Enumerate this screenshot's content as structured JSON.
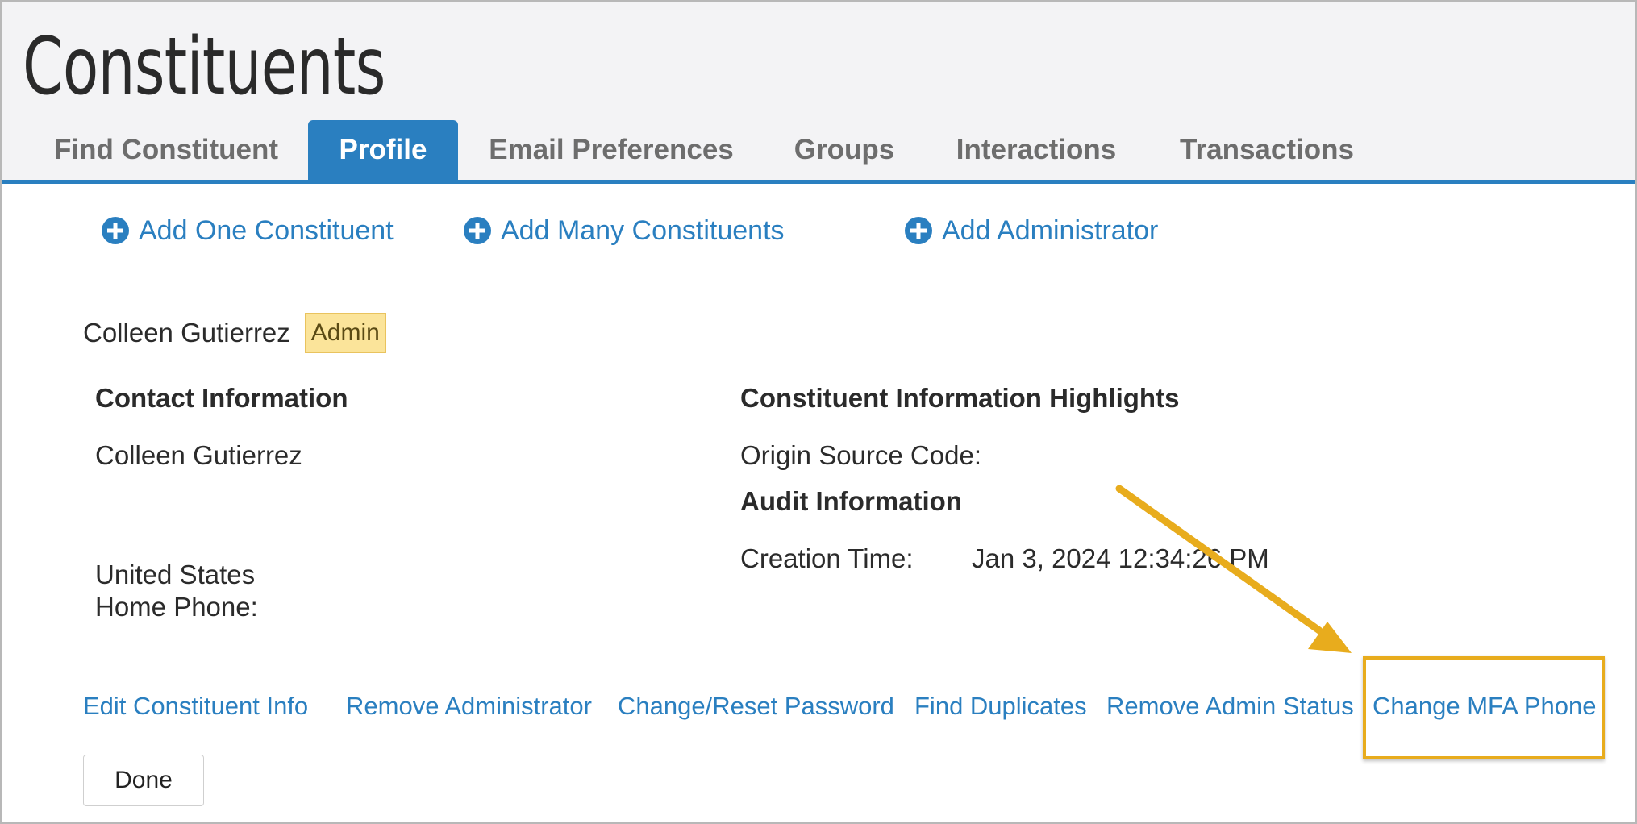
{
  "page": {
    "title": "Constituents"
  },
  "tabs": [
    {
      "label": "Find Constituent",
      "active": false
    },
    {
      "label": "Profile",
      "active": true
    },
    {
      "label": "Email Preferences",
      "active": false
    },
    {
      "label": "Groups",
      "active": false
    },
    {
      "label": "Interactions",
      "active": false
    },
    {
      "label": "Transactions",
      "active": false
    }
  ],
  "add_links": {
    "add_one": "Add One Constituent",
    "add_many": "Add Many Constituents",
    "add_admin": "Add Administrator"
  },
  "constituent": {
    "name": "Colleen Gutierrez",
    "badge": "Admin"
  },
  "contact": {
    "heading": "Contact Information",
    "name": "Colleen Gutierrez",
    "country": "United States",
    "home_phone_label": "Home Phone:"
  },
  "highlights": {
    "heading": "Constituent Information Highlights",
    "origin_label": "Origin Source Code:",
    "audit_heading": "Audit Information",
    "creation_label": "Creation Time:",
    "creation_value": "Jan 3, 2024 12:34:26 PM"
  },
  "actions": {
    "edit_info": "Edit Constituent Info",
    "remove_admin": "Remove Administrator",
    "change_password": "Change/Reset Password",
    "find_duplicates": "Find Duplicates",
    "remove_admin_status": "Remove Admin Status",
    "change_mfa": "Change MFA Phone"
  },
  "done_label": "Done",
  "colors": {
    "accent": "#2a7fc0",
    "highlight": "#e8ac1d",
    "badge_bg": "#fbe49a"
  }
}
